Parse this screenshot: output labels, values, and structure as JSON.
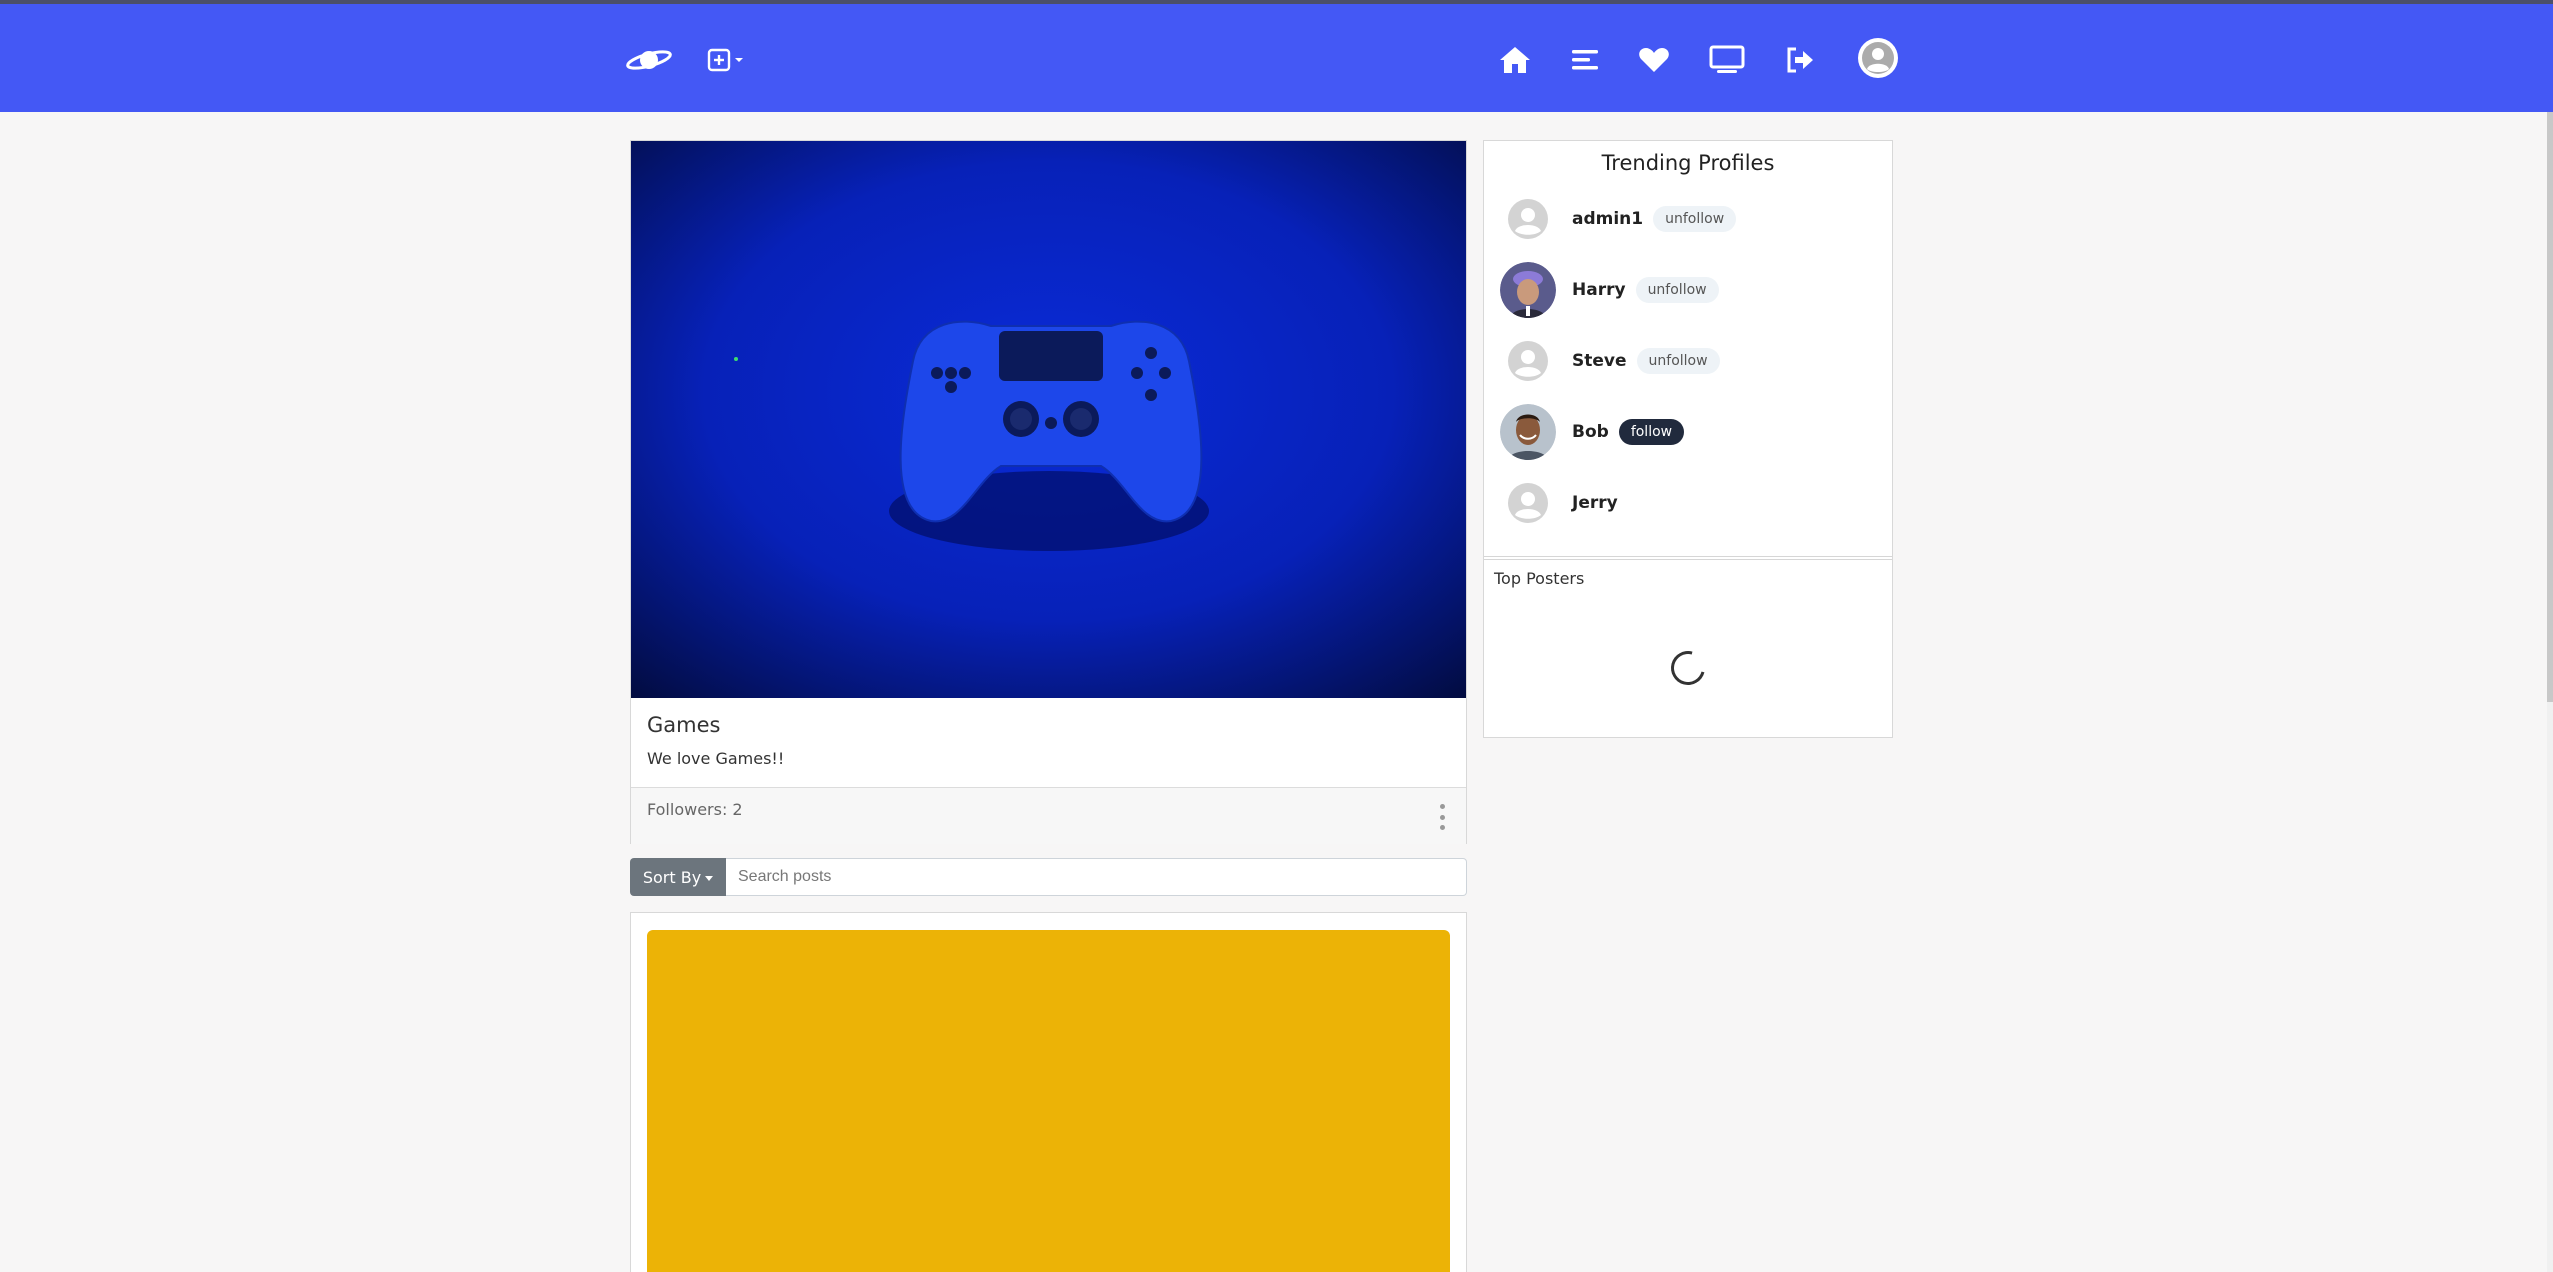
{
  "navbar": {
    "logo_icon": "planet-logo-icon",
    "create_icon": "add-square-icon",
    "nav_icons": [
      "home-icon",
      "list-icon",
      "heart-icon",
      "monitor-icon",
      "logout-icon",
      "user-avatar-icon"
    ],
    "background_color": "#4458f5"
  },
  "community": {
    "title": "Games",
    "description": "We love Games!!",
    "followers_label": "Followers: 2",
    "hero_icon": "game-controller-image"
  },
  "toolbar": {
    "sort_label": "Sort By",
    "search_placeholder": "Search posts"
  },
  "post": {
    "media_color": "#ecb306"
  },
  "trending": {
    "title": "Trending Profiles",
    "profiles": [
      {
        "name": "admin1",
        "action": "unfollow"
      },
      {
        "name": "Harry",
        "action": "unfollow"
      },
      {
        "name": "Steve",
        "action": "unfollow"
      },
      {
        "name": "Bob",
        "action": "follow"
      },
      {
        "name": "Jerry",
        "action": ""
      }
    ]
  },
  "top_posters": {
    "title": "Top Posters"
  }
}
